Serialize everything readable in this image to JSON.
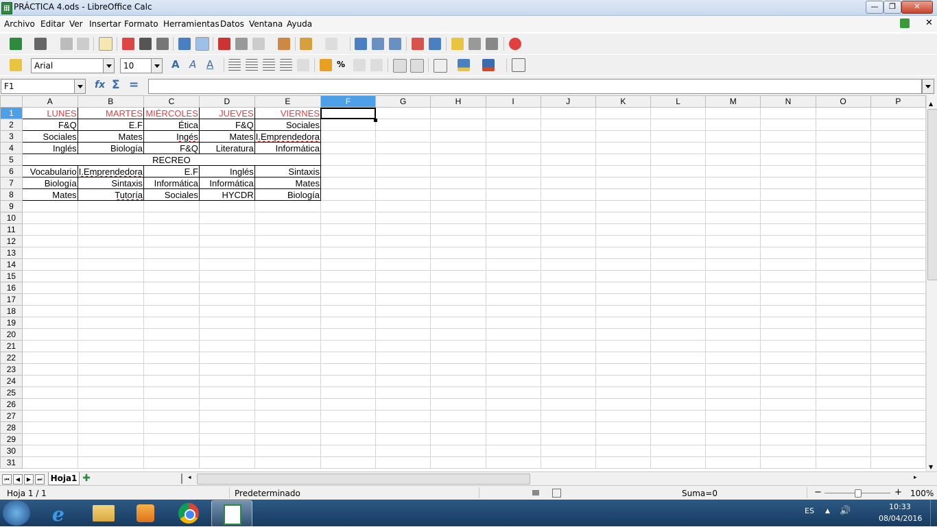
{
  "window": {
    "title": "PRÁCTICA 4.ods - LibreOffice Calc",
    "minimize_icon": "minimize-icon",
    "maximize_icon": "maximize-icon",
    "close_icon": "close-icon"
  },
  "menubar": {
    "items": [
      "Archivo",
      "Editar",
      "Ver",
      "Insertar",
      "Formato",
      "Herramientas",
      "Datos",
      "Ventana",
      "Ayuda"
    ]
  },
  "formatting": {
    "font_name": "Arial",
    "font_size": "10"
  },
  "formula_bar": {
    "name_box": "F1",
    "input_value": ""
  },
  "sheet": {
    "columns": [
      "A",
      "B",
      "C",
      "D",
      "E",
      "F",
      "G",
      "H",
      "I",
      "J",
      "K",
      "L",
      "M",
      "N",
      "O",
      "P"
    ],
    "rows": [
      "1",
      "2",
      "3",
      "4",
      "5",
      "6",
      "7",
      "8",
      "9",
      "10",
      "11",
      "12",
      "13",
      "14",
      "15",
      "16",
      "17",
      "18",
      "19",
      "20",
      "21",
      "22",
      "23",
      "24",
      "25",
      "26",
      "27",
      "28",
      "29",
      "30",
      "31"
    ],
    "active_cell": "F1",
    "data": {
      "r1": [
        "LUNES",
        "MARTES",
        "MIÉRCOLES",
        "JUEVES",
        "VIERNES"
      ],
      "r2": [
        "F&Q",
        "E.F",
        "Ética",
        "F&Q",
        "Sociales"
      ],
      "r3": [
        "Sociales",
        "Mates",
        "Ingés",
        "Mates",
        "I.Emprendedora"
      ],
      "r4": [
        "Inglés",
        "Biología",
        "F&Q",
        "Literatura",
        "Informática"
      ],
      "r5": "RECREO",
      "r6": [
        "Vocabulario",
        "I.Emprendedora",
        "E.F",
        "Inglés",
        "Sintaxis"
      ],
      "r7": [
        "Biología",
        "Sintaxis",
        "Informática",
        "Informática",
        "Mates"
      ],
      "r8": [
        "Mates",
        "Tutoría",
        "Sociales",
        "HYCDR",
        "Biología"
      ]
    },
    "header_color": "#e04040"
  },
  "tabs": {
    "sheet_tab": "Hoja1",
    "add_icon": "add-sheet-icon"
  },
  "statusbar": {
    "sheet_position": "Hoja 1 / 1",
    "page_style": "Predeterminado",
    "sum": "Suma=0",
    "zoom": "100%"
  },
  "taskbar": {
    "language": "ES",
    "time": "10:33",
    "date": "08/04/2016"
  }
}
